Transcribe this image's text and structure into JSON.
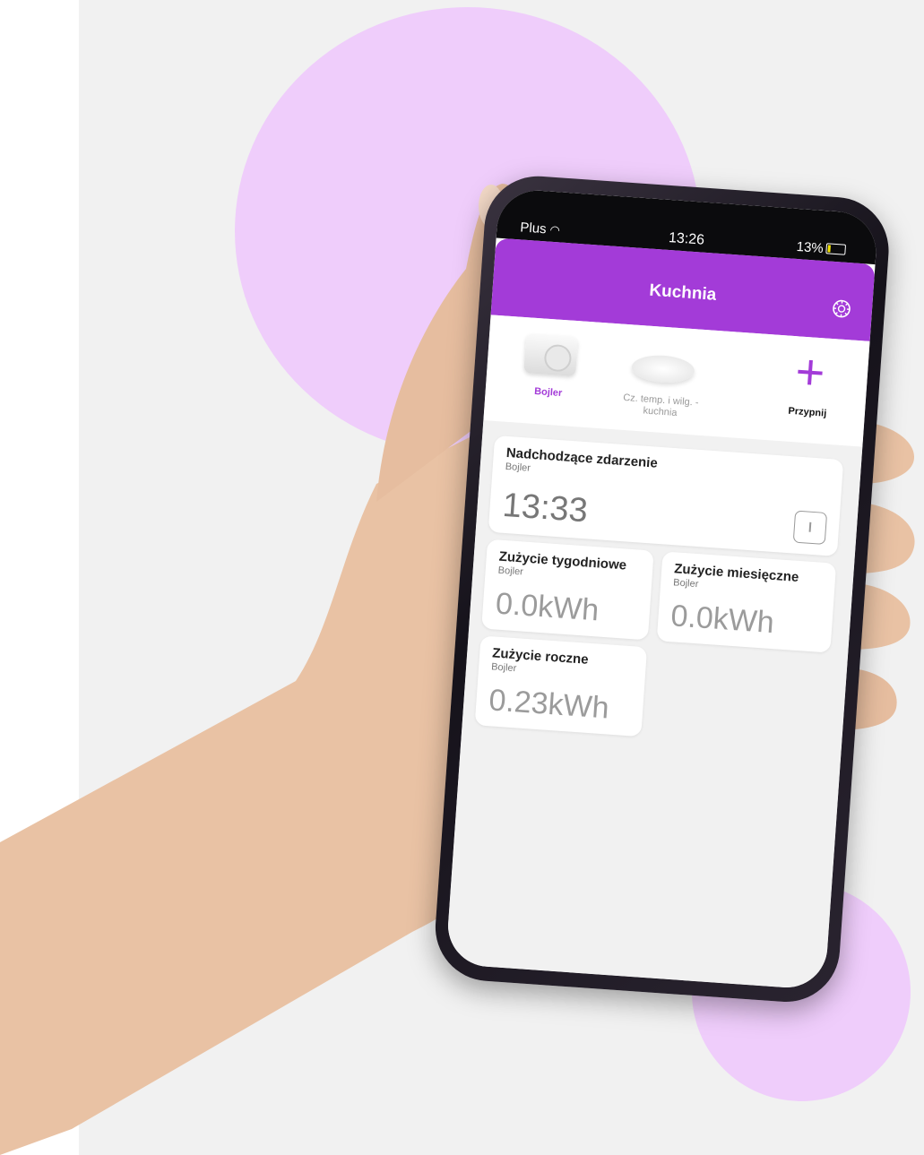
{
  "status_bar": {
    "carrier": "Plus",
    "time": "13:26",
    "battery": "13%"
  },
  "header": {
    "title": "Kuchnia"
  },
  "tabs": [
    {
      "label": "Bojler",
      "icon": "smart-plug"
    },
    {
      "label": "Cz. temp. i wilg. - kuchnia",
      "icon": "sensor"
    },
    {
      "label": "Przypnij",
      "icon": "plus-icon"
    }
  ],
  "cards": {
    "upcoming": {
      "title": "Nadchodzące zdarzenie",
      "sub": "Bojler",
      "value": "13:33"
    },
    "weekly": {
      "title": "Zużycie tygodniowe",
      "sub": "Bojler",
      "value": "0.0kWh"
    },
    "monthly": {
      "title": "Zużycie miesięczne",
      "sub": "Bojler",
      "value": "0.0kWh"
    },
    "yearly": {
      "title": "Zużycie roczne",
      "sub": "Bojler",
      "value": "0.23kWh"
    }
  },
  "colors": {
    "accent": "#a33bd8",
    "blob": "#efcdfb",
    "background": "#f1f1f1"
  }
}
